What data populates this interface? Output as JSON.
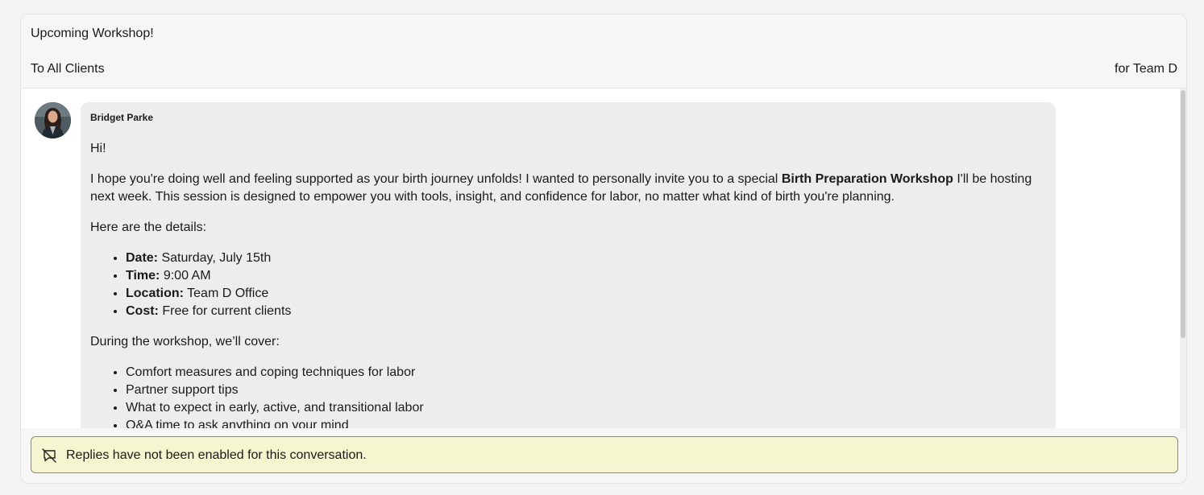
{
  "header": {
    "subject": "Upcoming Workshop!",
    "recipients": "To All Clients",
    "team": "for Team D"
  },
  "message": {
    "sender": "Bridget Parke",
    "avatar_icon": "person-photo-icon",
    "greeting": "Hi!",
    "intro_before": "I hope you're doing well and feeling supported as your birth journey unfolds! I wanted to personally invite you to a special ",
    "intro_bold": "Birth Preparation Workshop",
    "intro_after": " I'll be hosting next week. This session is designed to empower you with tools, insight, and confidence for labor, no matter what kind of birth you're planning.",
    "details_heading": "Here are the details:",
    "details": [
      {
        "label": "Date:",
        "value": " Saturday, July 15th"
      },
      {
        "label": "Time:",
        "value": " 9:00 AM"
      },
      {
        "label": "Location:",
        "value": " Team D Office"
      },
      {
        "label": "Cost:",
        "value": " Free for current clients"
      }
    ],
    "cover_heading": "During the workshop, we’ll cover:",
    "topics": [
      "Comfort measures and coping techniques for labor",
      "Partner support tips",
      "What to expect in early, active, and transitional labor",
      "Q&A time to ask anything on your mind"
    ]
  },
  "notice": {
    "icon": "comment-disabled-icon",
    "text": "Replies have not been enabled for this conversation."
  },
  "colors": {
    "bubble": "#ededed",
    "notice_bg": "#f5f5cf",
    "card_bg": "#f6f6f6"
  }
}
